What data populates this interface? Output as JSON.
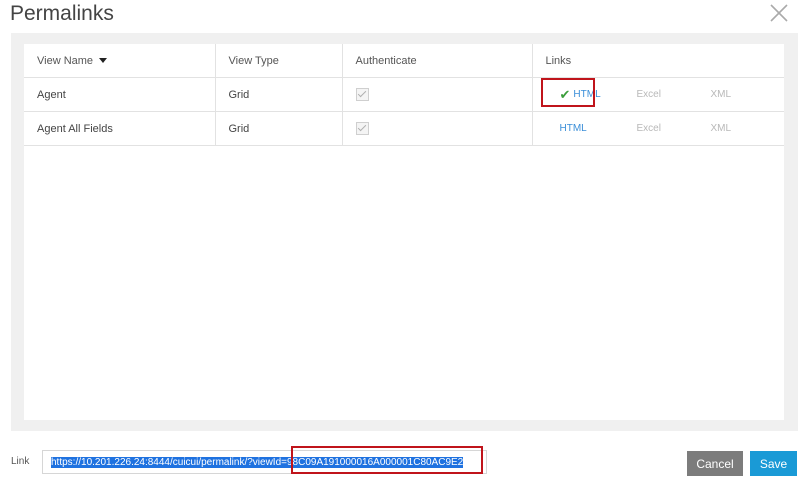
{
  "dialog": {
    "title": "Permalinks"
  },
  "table": {
    "columns": [
      "View Name",
      "View Type",
      "Authenticate",
      "Links"
    ],
    "rows": [
      {
        "view_name": "Agent",
        "view_type": "Grid",
        "authenticate": true,
        "links": {
          "html": "HTML",
          "excel": "Excel",
          "xml": "XML"
        },
        "html_selected": true
      },
      {
        "view_name": "Agent All Fields",
        "view_type": "Grid",
        "authenticate": true,
        "links": {
          "html": "HTML",
          "excel": "Excel",
          "xml": "XML"
        },
        "html_selected": false
      }
    ]
  },
  "link": {
    "label": "Link",
    "value": "https://10.201.226.24:8444/cuicui/permalink/?viewId=98C09A191000016A000001C80AC9E2"
  },
  "buttons": {
    "cancel": "Cancel",
    "save": "Save"
  },
  "colors": {
    "accent": "#1a9ad6",
    "link": "#3a8ed8",
    "highlight": "#c0141b",
    "selected_check": "#3b9e3b"
  }
}
